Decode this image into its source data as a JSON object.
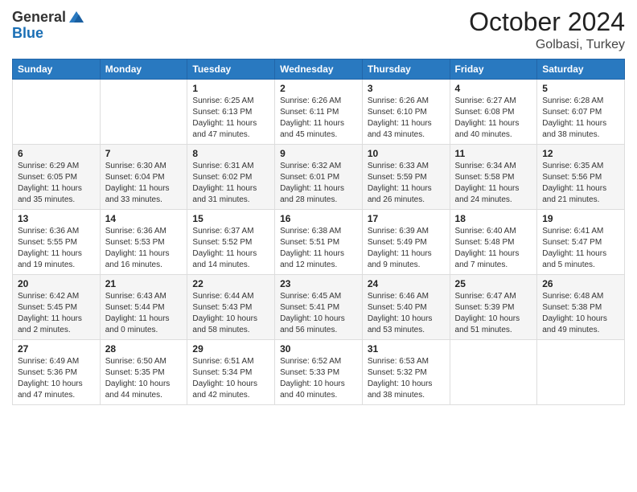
{
  "header": {
    "logo_general": "General",
    "logo_blue": "Blue",
    "month": "October 2024",
    "location": "Golbasi, Turkey"
  },
  "weekdays": [
    "Sunday",
    "Monday",
    "Tuesday",
    "Wednesday",
    "Thursday",
    "Friday",
    "Saturday"
  ],
  "weeks": [
    [
      {
        "day": "",
        "sunrise": "",
        "sunset": "",
        "daylight": ""
      },
      {
        "day": "",
        "sunrise": "",
        "sunset": "",
        "daylight": ""
      },
      {
        "day": "1",
        "sunrise": "Sunrise: 6:25 AM",
        "sunset": "Sunset: 6:13 PM",
        "daylight": "Daylight: 11 hours and 47 minutes."
      },
      {
        "day": "2",
        "sunrise": "Sunrise: 6:26 AM",
        "sunset": "Sunset: 6:11 PM",
        "daylight": "Daylight: 11 hours and 45 minutes."
      },
      {
        "day": "3",
        "sunrise": "Sunrise: 6:26 AM",
        "sunset": "Sunset: 6:10 PM",
        "daylight": "Daylight: 11 hours and 43 minutes."
      },
      {
        "day": "4",
        "sunrise": "Sunrise: 6:27 AM",
        "sunset": "Sunset: 6:08 PM",
        "daylight": "Daylight: 11 hours and 40 minutes."
      },
      {
        "day": "5",
        "sunrise": "Sunrise: 6:28 AM",
        "sunset": "Sunset: 6:07 PM",
        "daylight": "Daylight: 11 hours and 38 minutes."
      }
    ],
    [
      {
        "day": "6",
        "sunrise": "Sunrise: 6:29 AM",
        "sunset": "Sunset: 6:05 PM",
        "daylight": "Daylight: 11 hours and 35 minutes."
      },
      {
        "day": "7",
        "sunrise": "Sunrise: 6:30 AM",
        "sunset": "Sunset: 6:04 PM",
        "daylight": "Daylight: 11 hours and 33 minutes."
      },
      {
        "day": "8",
        "sunrise": "Sunrise: 6:31 AM",
        "sunset": "Sunset: 6:02 PM",
        "daylight": "Daylight: 11 hours and 31 minutes."
      },
      {
        "day": "9",
        "sunrise": "Sunrise: 6:32 AM",
        "sunset": "Sunset: 6:01 PM",
        "daylight": "Daylight: 11 hours and 28 minutes."
      },
      {
        "day": "10",
        "sunrise": "Sunrise: 6:33 AM",
        "sunset": "Sunset: 5:59 PM",
        "daylight": "Daylight: 11 hours and 26 minutes."
      },
      {
        "day": "11",
        "sunrise": "Sunrise: 6:34 AM",
        "sunset": "Sunset: 5:58 PM",
        "daylight": "Daylight: 11 hours and 24 minutes."
      },
      {
        "day": "12",
        "sunrise": "Sunrise: 6:35 AM",
        "sunset": "Sunset: 5:56 PM",
        "daylight": "Daylight: 11 hours and 21 minutes."
      }
    ],
    [
      {
        "day": "13",
        "sunrise": "Sunrise: 6:36 AM",
        "sunset": "Sunset: 5:55 PM",
        "daylight": "Daylight: 11 hours and 19 minutes."
      },
      {
        "day": "14",
        "sunrise": "Sunrise: 6:36 AM",
        "sunset": "Sunset: 5:53 PM",
        "daylight": "Daylight: 11 hours and 16 minutes."
      },
      {
        "day": "15",
        "sunrise": "Sunrise: 6:37 AM",
        "sunset": "Sunset: 5:52 PM",
        "daylight": "Daylight: 11 hours and 14 minutes."
      },
      {
        "day": "16",
        "sunrise": "Sunrise: 6:38 AM",
        "sunset": "Sunset: 5:51 PM",
        "daylight": "Daylight: 11 hours and 12 minutes."
      },
      {
        "day": "17",
        "sunrise": "Sunrise: 6:39 AM",
        "sunset": "Sunset: 5:49 PM",
        "daylight": "Daylight: 11 hours and 9 minutes."
      },
      {
        "day": "18",
        "sunrise": "Sunrise: 6:40 AM",
        "sunset": "Sunset: 5:48 PM",
        "daylight": "Daylight: 11 hours and 7 minutes."
      },
      {
        "day": "19",
        "sunrise": "Sunrise: 6:41 AM",
        "sunset": "Sunset: 5:47 PM",
        "daylight": "Daylight: 11 hours and 5 minutes."
      }
    ],
    [
      {
        "day": "20",
        "sunrise": "Sunrise: 6:42 AM",
        "sunset": "Sunset: 5:45 PM",
        "daylight": "Daylight: 11 hours and 2 minutes."
      },
      {
        "day": "21",
        "sunrise": "Sunrise: 6:43 AM",
        "sunset": "Sunset: 5:44 PM",
        "daylight": "Daylight: 11 hours and 0 minutes."
      },
      {
        "day": "22",
        "sunrise": "Sunrise: 6:44 AM",
        "sunset": "Sunset: 5:43 PM",
        "daylight": "Daylight: 10 hours and 58 minutes."
      },
      {
        "day": "23",
        "sunrise": "Sunrise: 6:45 AM",
        "sunset": "Sunset: 5:41 PM",
        "daylight": "Daylight: 10 hours and 56 minutes."
      },
      {
        "day": "24",
        "sunrise": "Sunrise: 6:46 AM",
        "sunset": "Sunset: 5:40 PM",
        "daylight": "Daylight: 10 hours and 53 minutes."
      },
      {
        "day": "25",
        "sunrise": "Sunrise: 6:47 AM",
        "sunset": "Sunset: 5:39 PM",
        "daylight": "Daylight: 10 hours and 51 minutes."
      },
      {
        "day": "26",
        "sunrise": "Sunrise: 6:48 AM",
        "sunset": "Sunset: 5:38 PM",
        "daylight": "Daylight: 10 hours and 49 minutes."
      }
    ],
    [
      {
        "day": "27",
        "sunrise": "Sunrise: 6:49 AM",
        "sunset": "Sunset: 5:36 PM",
        "daylight": "Daylight: 10 hours and 47 minutes."
      },
      {
        "day": "28",
        "sunrise": "Sunrise: 6:50 AM",
        "sunset": "Sunset: 5:35 PM",
        "daylight": "Daylight: 10 hours and 44 minutes."
      },
      {
        "day": "29",
        "sunrise": "Sunrise: 6:51 AM",
        "sunset": "Sunset: 5:34 PM",
        "daylight": "Daylight: 10 hours and 42 minutes."
      },
      {
        "day": "30",
        "sunrise": "Sunrise: 6:52 AM",
        "sunset": "Sunset: 5:33 PM",
        "daylight": "Daylight: 10 hours and 40 minutes."
      },
      {
        "day": "31",
        "sunrise": "Sunrise: 6:53 AM",
        "sunset": "Sunset: 5:32 PM",
        "daylight": "Daylight: 10 hours and 38 minutes."
      },
      {
        "day": "",
        "sunrise": "",
        "sunset": "",
        "daylight": ""
      },
      {
        "day": "",
        "sunrise": "",
        "sunset": "",
        "daylight": ""
      }
    ]
  ]
}
